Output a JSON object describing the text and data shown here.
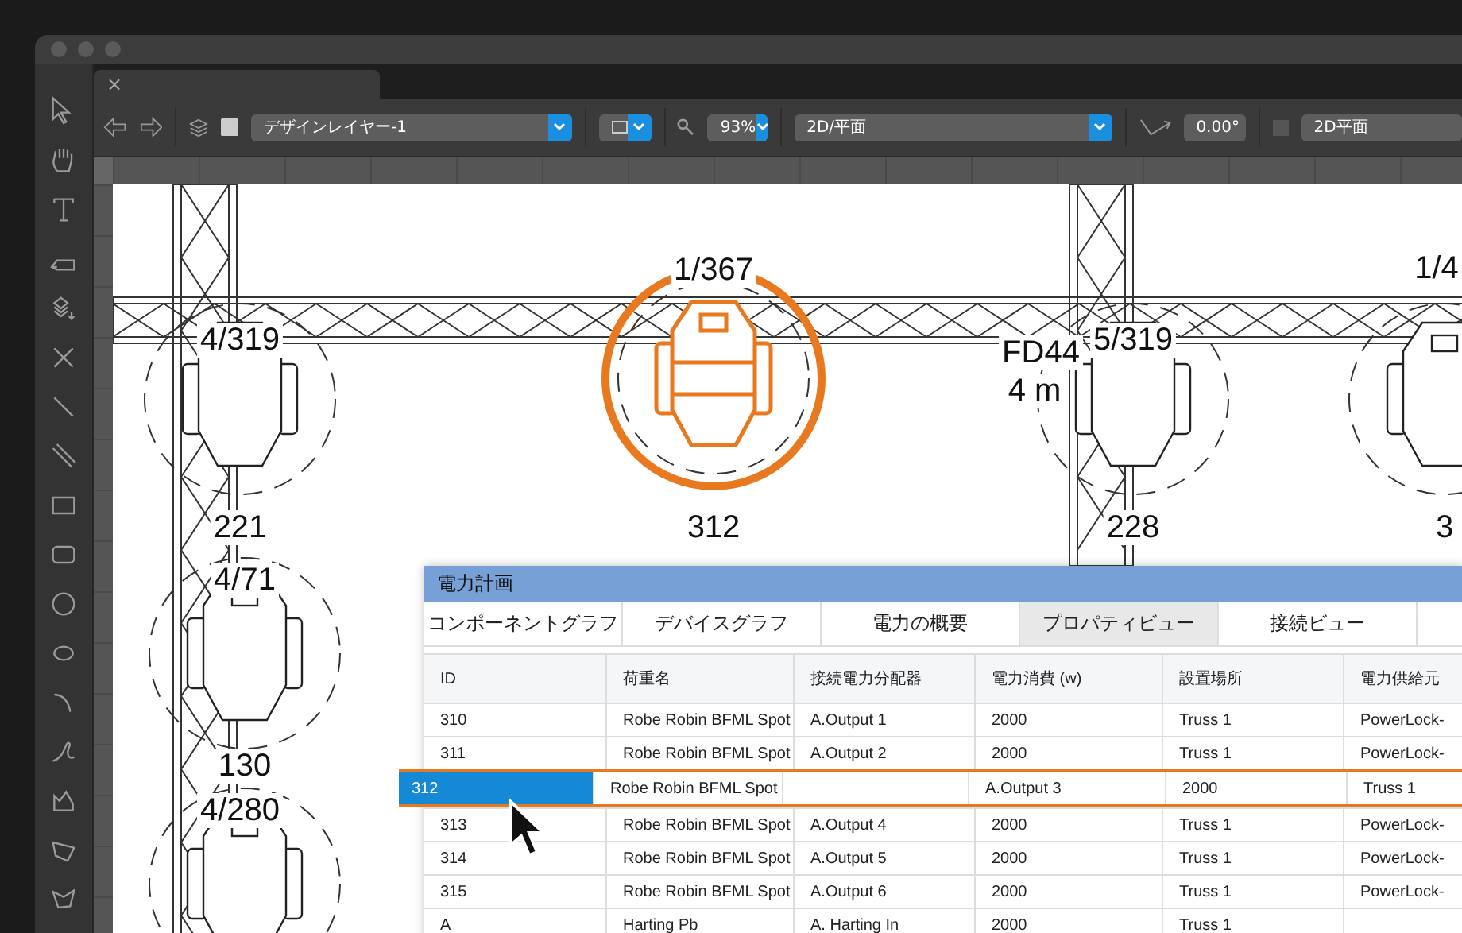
{
  "window": {
    "tab_close": "×"
  },
  "toolbar": {
    "layer": "デザインレイヤー-1",
    "zoom": "93%",
    "view": "2D/平面",
    "angle": "0.00°",
    "render_mode": "2D平面"
  },
  "canvas": {
    "fixtures": [
      {
        "label": "4/319",
        "number": "221",
        "selected": false
      },
      {
        "label": "1/367",
        "number": "312",
        "selected": true
      },
      {
        "label": "5/319",
        "number": "228",
        "selected": false
      },
      {
        "label": "1/4",
        "number": "3",
        "selected": false
      },
      {
        "label": "4/71",
        "number": "130",
        "selected": false
      },
      {
        "label": "4/280",
        "selected": false
      }
    ],
    "notes": [
      "FD44",
      "4 m"
    ]
  },
  "panel": {
    "title": "電力計画",
    "tabs": [
      {
        "label": "コンポーネントグラフ",
        "selected": false
      },
      {
        "label": "デバイスグラフ",
        "selected": false
      },
      {
        "label": "電力の概要",
        "selected": false
      },
      {
        "label": "プロパティビュー",
        "selected": true
      },
      {
        "label": "接続ビュー",
        "selected": false
      }
    ],
    "columns": [
      "ID",
      "荷重名",
      "接続電力分配器",
      "電力消費 (w)",
      "設置場所",
      "電力供給元"
    ],
    "rows": [
      {
        "cells": [
          "310",
          "Robe Robin BFML Spot",
          "A.Output 1",
          "2000",
          "Truss 1",
          "PowerLock-"
        ],
        "selected": false
      },
      {
        "cells": [
          "311",
          "Robe Robin BFML Spot",
          "A.Output 2",
          "2000",
          "Truss 1",
          "PowerLock-"
        ],
        "selected": false
      },
      {
        "cells": [
          "312",
          "Robe Robin BFML Spot",
          null,
          "A.Output 3",
          "2000",
          "Truss 1"
        ],
        "selected": true
      },
      {
        "cells": [
          "313",
          "Robe Robin BFML Spot",
          "A.Output 4",
          "2000",
          "Truss 1",
          "PowerLock-"
        ],
        "selected": false
      },
      {
        "cells": [
          "314",
          "Robe Robin BFML Spot",
          "A.Output 5",
          "2000",
          "Truss 1",
          "PowerLock-"
        ],
        "selected": false
      },
      {
        "cells": [
          "315",
          "Robe Robin BFML Spot",
          "A.Output 6",
          "2000",
          "Truss 1",
          "PowerLock-"
        ],
        "selected": false
      },
      {
        "cells": [
          "A",
          "Harting Pb",
          "A. Harting In",
          "2000",
          "Truss 1",
          null
        ],
        "selected": false
      }
    ]
  }
}
